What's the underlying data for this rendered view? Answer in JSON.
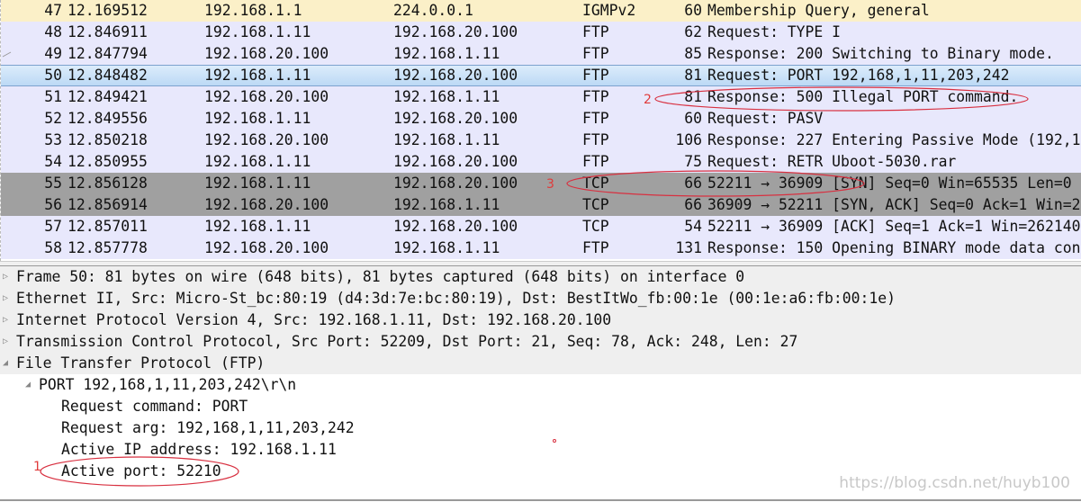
{
  "colors": {
    "igmp_row": "#fbf0c8",
    "ftp_row": "#e8e8fc",
    "selected_row": "#c9e0f7",
    "tcp_syn_row": "#a0a0a0",
    "annotation": "#d83040"
  },
  "packets": [
    {
      "no": "47",
      "time": "12.169512",
      "src": "192.168.1.1",
      "dst": "224.0.0.1",
      "proto": "IGMPv2",
      "len": "60",
      "info": "Membership Query, general",
      "bg": "#fbf0c8"
    },
    {
      "no": "48",
      "time": "12.846911",
      "src": "192.168.1.11",
      "dst": "192.168.20.100",
      "proto": "FTP",
      "len": "62",
      "info": "Request: TYPE I",
      "bg": "#e8e8fc"
    },
    {
      "no": "49",
      "time": "12.847794",
      "src": "192.168.20.100",
      "dst": "192.168.1.11",
      "proto": "FTP",
      "len": "85",
      "info": "Response: 200 Switching to Binary mode.",
      "bg": "#e8e8fc"
    },
    {
      "no": "50",
      "time": "12.848482",
      "src": "192.168.1.11",
      "dst": "192.168.20.100",
      "proto": "FTP",
      "len": "81",
      "info": "Request: PORT 192,168,1,11,203,242",
      "bg": "sel"
    },
    {
      "no": "51",
      "time": "12.849421",
      "src": "192.168.20.100",
      "dst": "192.168.1.11",
      "proto": "FTP",
      "len": "81",
      "info": "Response: 500 Illegal PORT command.",
      "bg": "#e8e8fc"
    },
    {
      "no": "52",
      "time": "12.849556",
      "src": "192.168.1.11",
      "dst": "192.168.20.100",
      "proto": "FTP",
      "len": "60",
      "info": "Request: PASV",
      "bg": "#e8e8fc"
    },
    {
      "no": "53",
      "time": "12.850218",
      "src": "192.168.20.100",
      "dst": "192.168.1.11",
      "proto": "FTP",
      "len": "106",
      "info": "Response: 227 Entering Passive Mode (192,1",
      "bg": "#e8e8fc"
    },
    {
      "no": "54",
      "time": "12.850955",
      "src": "192.168.1.11",
      "dst": "192.168.20.100",
      "proto": "FTP",
      "len": "75",
      "info": "Request: RETR Uboot-5030.rar",
      "bg": "#e8e8fc"
    },
    {
      "no": "55",
      "time": "12.856128",
      "src": "192.168.1.11",
      "dst": "192.168.20.100",
      "proto": "TCP",
      "len": "66",
      "info": "52211 → 36909 [SYN] Seq=0 Win=65535 Len=0",
      "bg": "#a0a0a0"
    },
    {
      "no": "56",
      "time": "12.856914",
      "src": "192.168.20.100",
      "dst": "192.168.1.11",
      "proto": "TCP",
      "len": "66",
      "info": "36909 → 52211 [SYN, ACK] Seq=0 Ack=1 Win=2",
      "bg": "#a0a0a0"
    },
    {
      "no": "57",
      "time": "12.857011",
      "src": "192.168.1.11",
      "dst": "192.168.20.100",
      "proto": "TCP",
      "len": "54",
      "info": "52211 → 36909 [ACK] Seq=1 Ack=1 Win=262140",
      "bg": "#e8e8fc"
    },
    {
      "no": "58",
      "time": "12.857778",
      "src": "192.168.20.100",
      "dst": "192.168.1.11",
      "proto": "FTP",
      "len": "131",
      "info": "Response: 150 Opening BINARY mode data con",
      "bg": "#e8e8fc"
    }
  ],
  "details": [
    {
      "text": "Frame 50: 81 bytes on wire (648 bits), 81 bytes captured (648 bits) on interface 0",
      "indent": 0,
      "state": "collapsed",
      "hdr": true
    },
    {
      "text": "Ethernet II, Src: Micro-St_bc:80:19 (d4:3d:7e:bc:80:19), Dst: BestItWo_fb:00:1e (00:1e:a6:fb:00:1e)",
      "indent": 0,
      "state": "collapsed",
      "hdr": true
    },
    {
      "text": "Internet Protocol Version 4, Src: 192.168.1.11, Dst: 192.168.20.100",
      "indent": 0,
      "state": "collapsed",
      "hdr": true
    },
    {
      "text": "Transmission Control Protocol, Src Port: 52209, Dst Port: 21, Seq: 78, Ack: 248, Len: 27",
      "indent": 0,
      "state": "collapsed",
      "hdr": true
    },
    {
      "text": "File Transfer Protocol (FTP)",
      "indent": 0,
      "state": "expanded",
      "hdr": true
    },
    {
      "text": "PORT 192,168,1,11,203,242\\r\\n",
      "indent": 1,
      "state": "expanded",
      "hdr": false
    },
    {
      "text": "Request command: PORT",
      "indent": 2,
      "state": "leaf",
      "hdr": false
    },
    {
      "text": "Request arg: 192,168,1,11,203,242",
      "indent": 2,
      "state": "leaf",
      "hdr": false
    },
    {
      "text": "Active IP address: 192.168.1.11",
      "indent": 2,
      "state": "leaf",
      "hdr": false
    },
    {
      "text": "Active port: 52210",
      "indent": 2,
      "state": "leaf",
      "hdr": false
    }
  ],
  "annotations": {
    "n1": "1",
    "n2": "2",
    "n3": "3"
  },
  "watermark": "https://blog.csdn.net/huyb100"
}
